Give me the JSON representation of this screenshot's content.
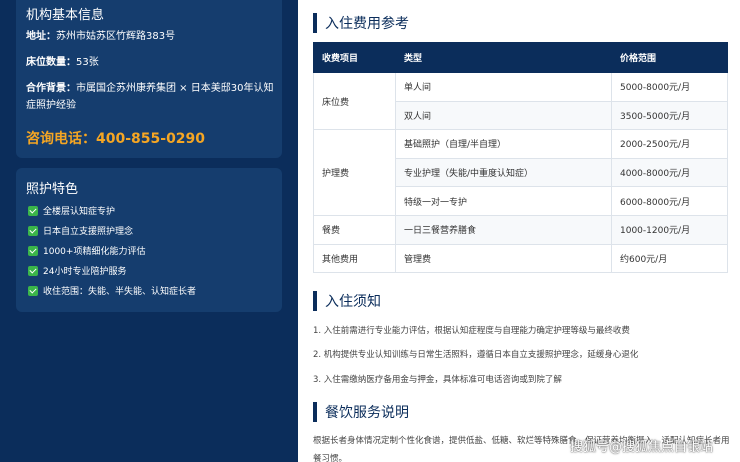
{
  "org": {
    "title": "机构基本信息",
    "address_label": "地址：",
    "address": "苏州市姑苏区竹辉路383号",
    "beds_label": "床位数量：",
    "beds": "53张",
    "background_label": "合作背景：",
    "background": "市属国企苏州康养集团 × 日本美邸30年认知症照护经验",
    "phone": "咨询电话：400-855-0290"
  },
  "features": {
    "title": "照护特色",
    "items": [
      "全楼层认知症专护",
      "日本自立支援照护理念",
      "1000+项精细化能力评估",
      "24小时专业陪护服务",
      "收住范围：失能、半失能、认知症长者"
    ]
  },
  "fees": {
    "title": "入住费用参考",
    "headers": [
      "收费项目",
      "类型",
      "价格范围"
    ],
    "rows": [
      {
        "item": "床位费",
        "type": "单人间",
        "price": "5000-8000元/月"
      },
      {
        "item": "",
        "type": "双人间",
        "price": "3500-5000元/月"
      },
      {
        "item": "护理费",
        "type": "基础照护（自理/半自理）",
        "price": "2000-2500元/月"
      },
      {
        "item": "",
        "type": "专业护理（失能/中重度认知症）",
        "price": "4000-8000元/月"
      },
      {
        "item": "",
        "type": "特级一对一专护",
        "price": "6000-8000元/月"
      },
      {
        "item": "餐费",
        "type": "一日三餐营养膳食",
        "price": "1000-1200元/月"
      },
      {
        "item": "其他费用",
        "type": "管理费",
        "price": "约600元/月"
      }
    ]
  },
  "notice": {
    "title": "入住须知",
    "items": [
      "1. 入住前需进行专业能力评估，根据认知症程度与自理能力确定护理等级与最终收费",
      "2. 机构提供专业认知训练与日常生活照料，遵循日本自立支援照护理念，延缓身心退化",
      "3. 入住需缴纳医疗备用金与押金，具体标准可电话咨询或到院了解"
    ]
  },
  "dining": {
    "title": "餐饮服务说明",
    "text": "根据长者身体情况定制个性化食谱，提供低盐、低糖、软烂等特殊膳食，保证营养均衡摄入，适配认知症长者用餐习惯。"
  },
  "watermark": "搜狐号@搜狐焦点自银站"
}
